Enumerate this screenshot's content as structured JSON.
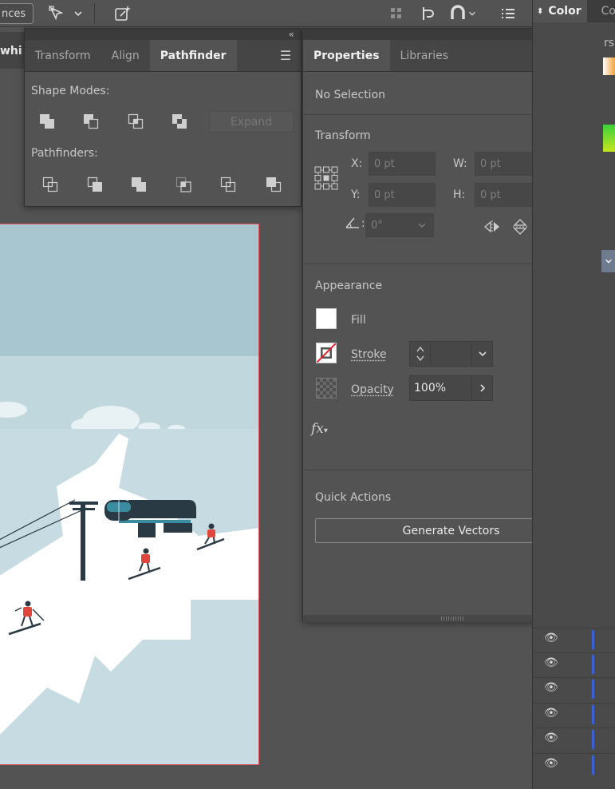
{
  "topbar": {
    "left_tab": "nces",
    "icons": [
      "selection-arrow-icon",
      "chevron-down-icon",
      "ai-transform-icon",
      "grid-icon",
      "snap-icon",
      "magnet-icon",
      "chevron-down-icon",
      "list-icon"
    ]
  },
  "docbar": {
    "label": "whi"
  },
  "pathfinder_panel": {
    "tabs": [
      "Transform",
      "Align",
      "Pathfinder"
    ],
    "active_tab": "Pathfinder",
    "shape_modes_label": "Shape Modes:",
    "expand_label": "Expand",
    "pathfinders_label": "Pathfinders:"
  },
  "properties_panel": {
    "tabs": [
      "Properties",
      "Libraries"
    ],
    "active_tab": "Properties",
    "no_selection": "No Selection",
    "transform": {
      "title": "Transform",
      "x_label": "X:",
      "x_value": "0 pt",
      "y_label": "Y:",
      "y_value": "0 pt",
      "w_label": "W:",
      "w_value": "0 pt",
      "h_label": "H:",
      "h_value": "0 pt",
      "angle_value": "0°"
    },
    "appearance": {
      "title": "Appearance",
      "fill_label": "Fill",
      "stroke_label": "Stroke",
      "opacity_label": "Opacity",
      "opacity_value": "100%",
      "fx_label": "fx"
    },
    "quick_actions": {
      "title": "Quick Actions",
      "generate_vectors": "Generate Vectors"
    }
  },
  "dock": {
    "color_tab": "Color",
    "partial_tab": "Co",
    "partial_letters": "rs",
    "layer_rows": 6
  },
  "colors": {
    "panel_bg": "#535353",
    "sky": "#a8c6d0",
    "snow": "#ffffff",
    "slope_shadow": "#c7dbe2",
    "skier_red": "#e0463c",
    "lift_dark": "#2a3a44",
    "accent_blue": "#3a62d4",
    "artboard_border": "#e0505b"
  }
}
